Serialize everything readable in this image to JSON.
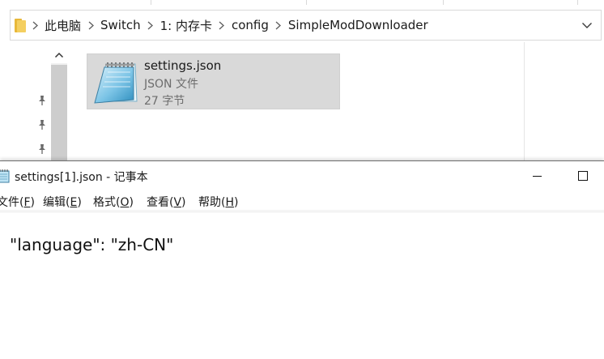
{
  "explorer": {
    "breadcrumbs": [
      "此电脑",
      "Switch",
      "1: 内存卡",
      "config",
      "SimpleModDownloader"
    ],
    "file": {
      "name": "settings.json",
      "type": "JSON 文件",
      "size": "27 字节"
    },
    "icons": {
      "folder": "folder-icon",
      "crumb_separator": "chevron-right-icon",
      "address_dropdown": "chevron-down-icon",
      "scroll_up": "chevron-up-icon",
      "pin": "pin-icon",
      "file": "notepad-file-icon"
    }
  },
  "notepad": {
    "title": "settings[1].json - 记事本",
    "menu": [
      {
        "label": "文件(",
        "key": "F",
        "end": ")"
      },
      {
        "label": "编辑(",
        "key": "E",
        "end": ")"
      },
      {
        "label": "格式(",
        "key": "O",
        "end": ")"
      },
      {
        "label": "查看(",
        "key": "V",
        "end": ")"
      },
      {
        "label": "帮助(",
        "key": "H",
        "end": ")"
      }
    ],
    "content": "\"language\": \"zh-CN\"",
    "icons": {
      "app": "notepad-icon",
      "minimize": "minimize-icon",
      "maximize": "maximize-icon"
    }
  },
  "colors": {
    "selection": "#d9d9d9",
    "folder": "#f4cf60",
    "scrollbar_track": "#f0f0f0",
    "scrollbar_thumb": "#cdcdcd"
  }
}
